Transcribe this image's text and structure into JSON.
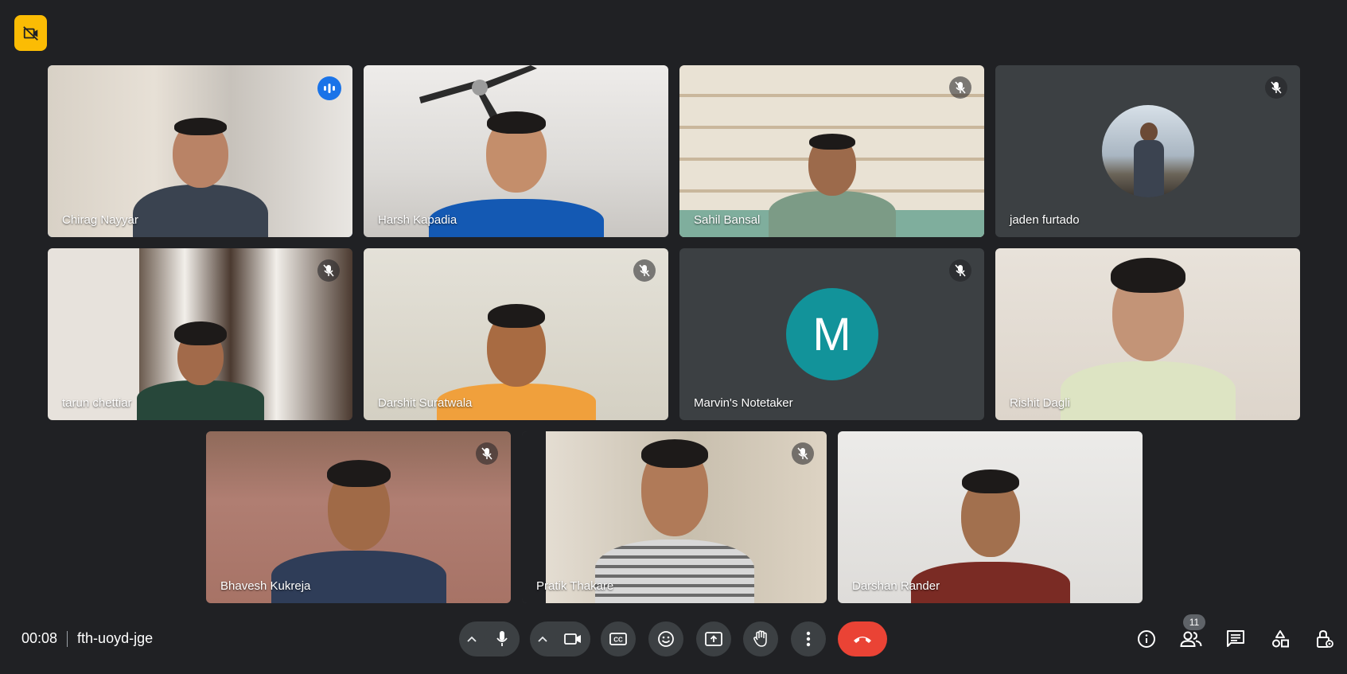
{
  "participants": [
    {
      "name": "Chirag Nayyar",
      "muted": false,
      "speaking": true
    },
    {
      "name": "Harsh Kapadia",
      "muted": false,
      "speaking": false
    },
    {
      "name": "Sahil Bansal",
      "muted": true,
      "speaking": false
    },
    {
      "name": "jaden furtado",
      "muted": true,
      "speaking": false
    },
    {
      "name": "tarun chettiar",
      "muted": true,
      "speaking": false
    },
    {
      "name": "Darshit Suratwala",
      "muted": true,
      "speaking": false
    },
    {
      "name": "Marvin's Notetaker",
      "muted": true,
      "speaking": false,
      "avatar_letter": "M"
    },
    {
      "name": "Rishit Dagli",
      "muted": false,
      "speaking": false
    },
    {
      "name": "Bhavesh Kukreja",
      "muted": true,
      "speaking": false
    },
    {
      "name": "Pratik Thakare",
      "muted": true,
      "speaking": false
    },
    {
      "name": "Darshan Rander",
      "muted": false,
      "speaking": false
    }
  ],
  "meeting": {
    "time": "00:08",
    "code": "fth-uoyd-jge"
  },
  "controls": {
    "people_count": "11",
    "icons": [
      "mic-icon",
      "camera-icon",
      "captions-icon",
      "emoji-icon",
      "present-icon",
      "hand-icon",
      "more-icon",
      "hangup-icon"
    ],
    "right_icons": [
      "info-icon",
      "people-icon",
      "chat-icon",
      "activities-icon",
      "host-controls-icon"
    ]
  },
  "colors": {
    "background": "#202124",
    "tile": "#3c4043",
    "accent": "#8ab4f8",
    "hangup": "#ea4335",
    "recording": "#fbbc04",
    "avatar_m": "#12939a"
  }
}
